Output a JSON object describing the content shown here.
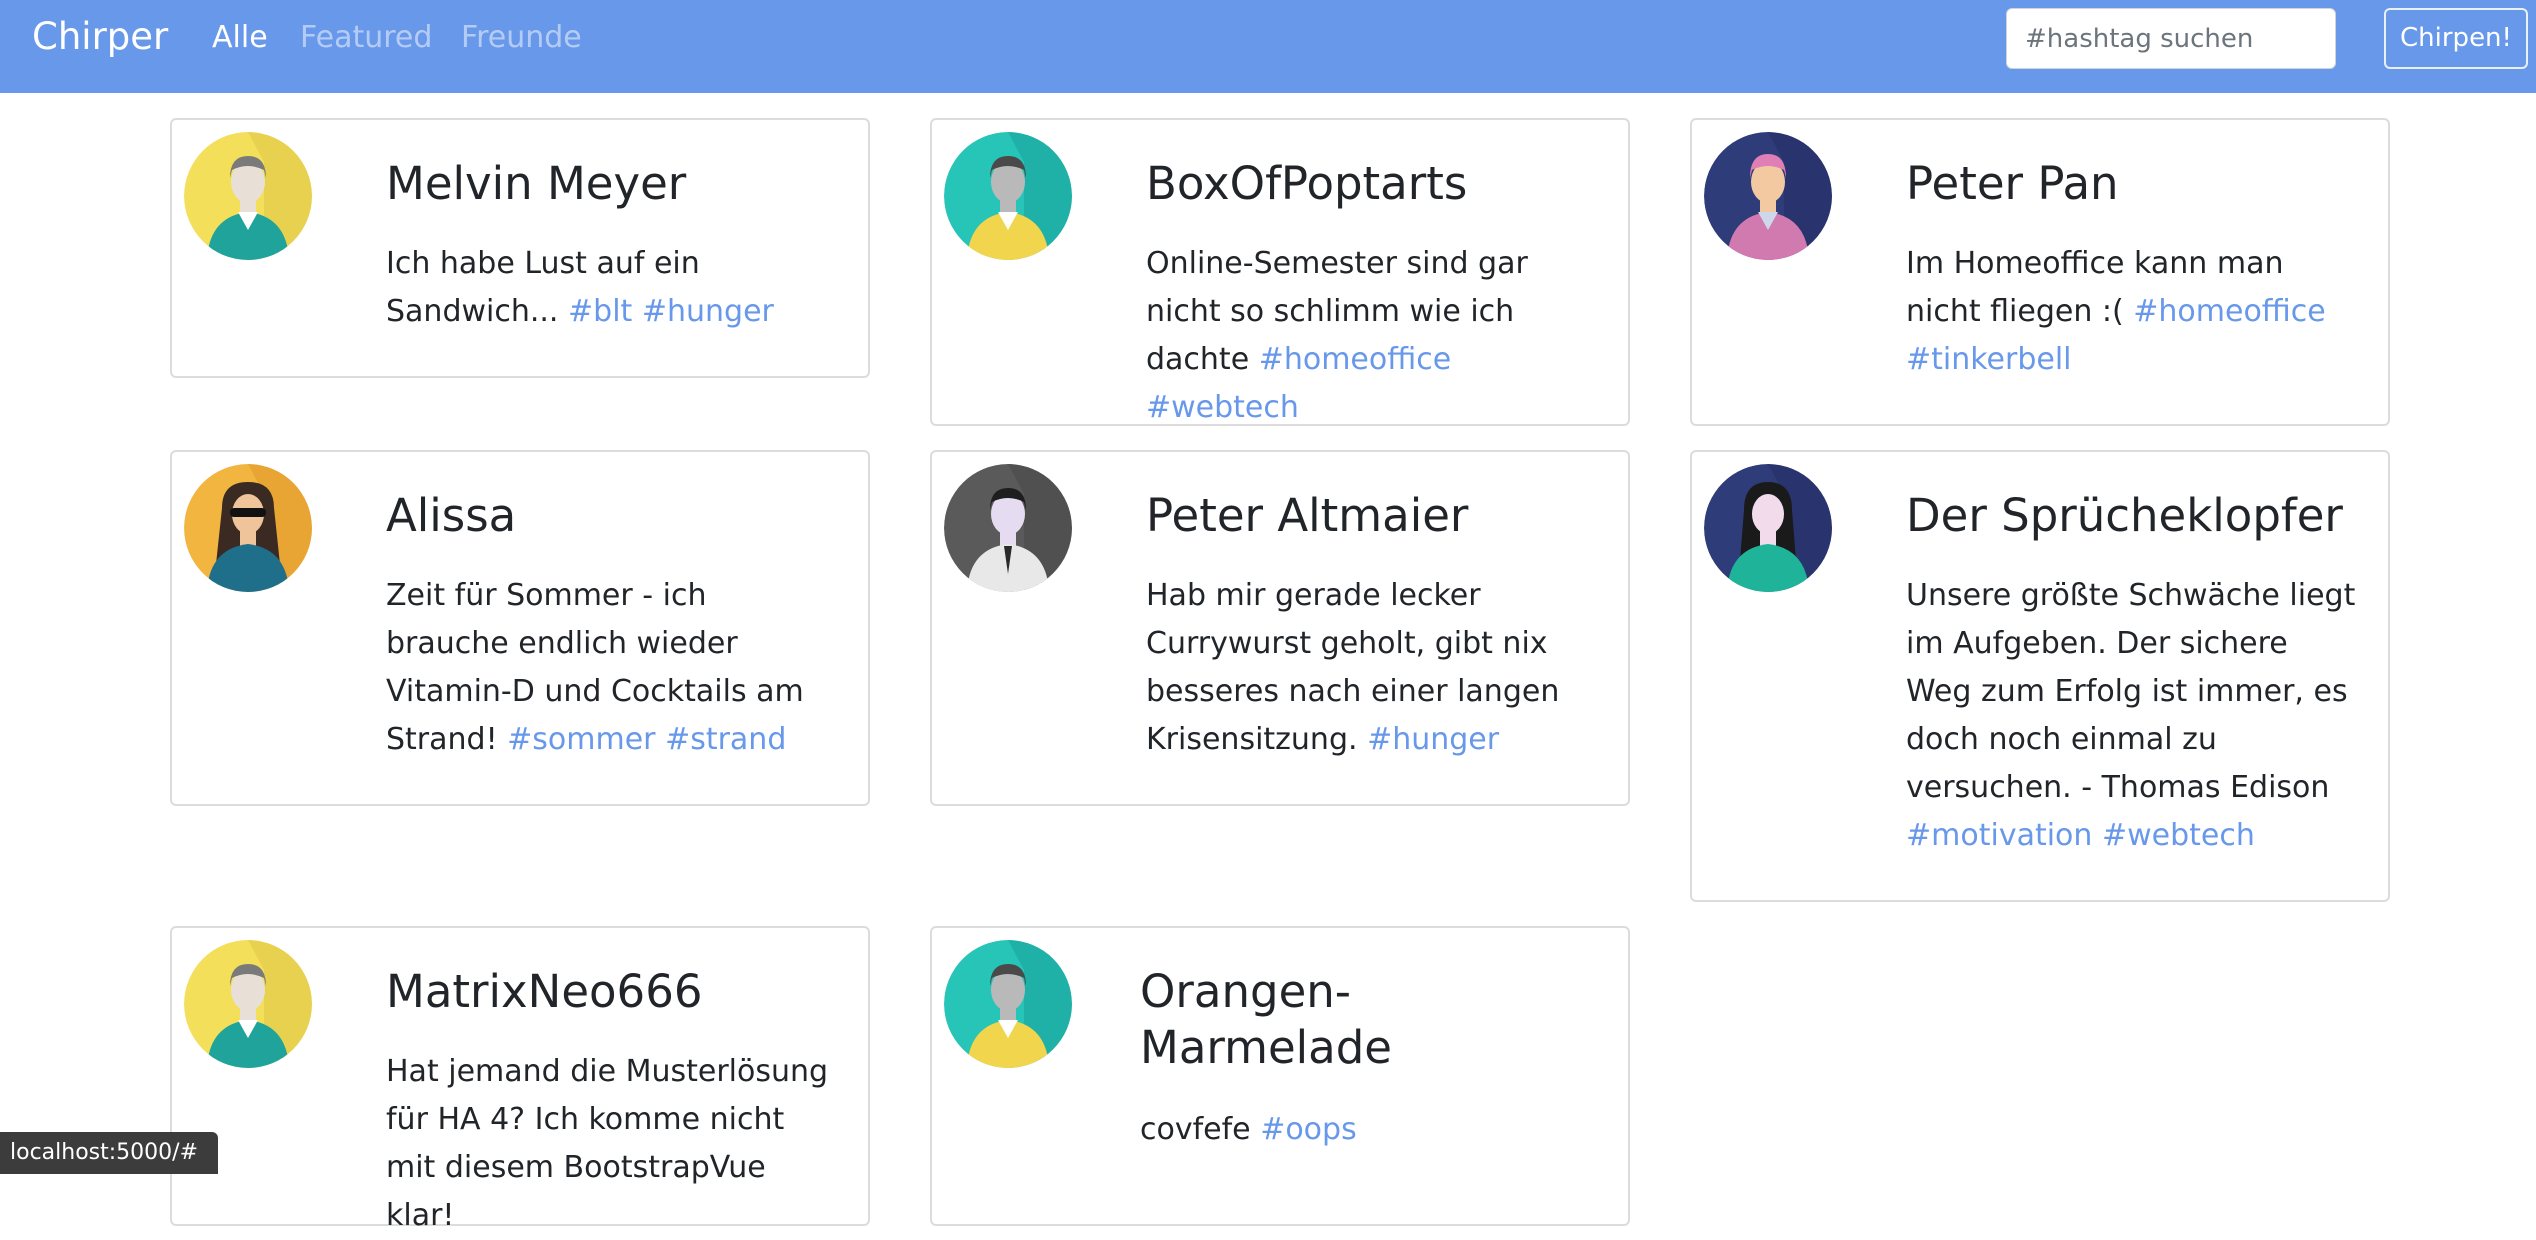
{
  "nav": {
    "brand": "Chirper",
    "links": [
      "Alle",
      "Featured",
      "Freunde"
    ],
    "search_placeholder": "#hashtag suchen",
    "chirp_button": "Chirpen!"
  },
  "colors": {
    "navbar": "#6898ea",
    "hashtag": "#6898ea"
  },
  "chirps": [
    {
      "author": "Melvin Meyer",
      "avatar": "man-yellow-avatar-icon",
      "text": "Ich habe Lust auf ein Sandwich...",
      "tags": [
        "#blt",
        "#hunger"
      ]
    },
    {
      "author": "BoxOfPoptarts",
      "avatar": "man-teal-avatar-icon",
      "text": "Online-Semester sind gar nicht so schlimm wie ich dachte",
      "tags": [
        "#homeoffice",
        "#webtech"
      ]
    },
    {
      "author": "Peter Pan",
      "avatar": "man-navy-avatar-icon",
      "text": "Im Homeoffice kann man nicht fliegen :(",
      "tags": [
        "#homeoffice",
        "#tinkerbell"
      ]
    },
    {
      "author": "Alissa",
      "avatar": "woman-sunglasses-avatar-icon",
      "text": "Zeit für Sommer - ich brauche endlich wieder Vitamin-D und Cocktails am Strand!",
      "tags": [
        "#sommer",
        "#strand"
      ]
    },
    {
      "author": "Peter Altmaier",
      "avatar": "man-grey-avatar-icon",
      "text": "Hab mir gerade lecker Currywurst geholt, gibt nix besseres nach einer langen Krisensitzung.",
      "tags": [
        "#hunger"
      ]
    },
    {
      "author": "Der Sprücheklopfer",
      "avatar": "woman-navy-avatar-icon",
      "text": "Unsere größte Schwäche liegt im Aufgeben. Der sichere Weg zum Erfolg ist immer, es doch noch einmal zu versuchen. - Thomas Edison",
      "tags": [
        "#motivation",
        "#webtech"
      ]
    },
    {
      "author": "MatrixNeo666",
      "avatar": "man-yellow-avatar-icon",
      "text": "Hat jemand die Musterlösung für HA 4? Ich komme nicht mit diesem BootstrapVue klar!",
      "tags": []
    },
    {
      "author": "Orangen-Marmelade",
      "avatar": "man-teal-avatar-icon",
      "text": "covfefe",
      "tags": [
        "#oops"
      ]
    }
  ],
  "status_bar": "localhost:5000/#"
}
